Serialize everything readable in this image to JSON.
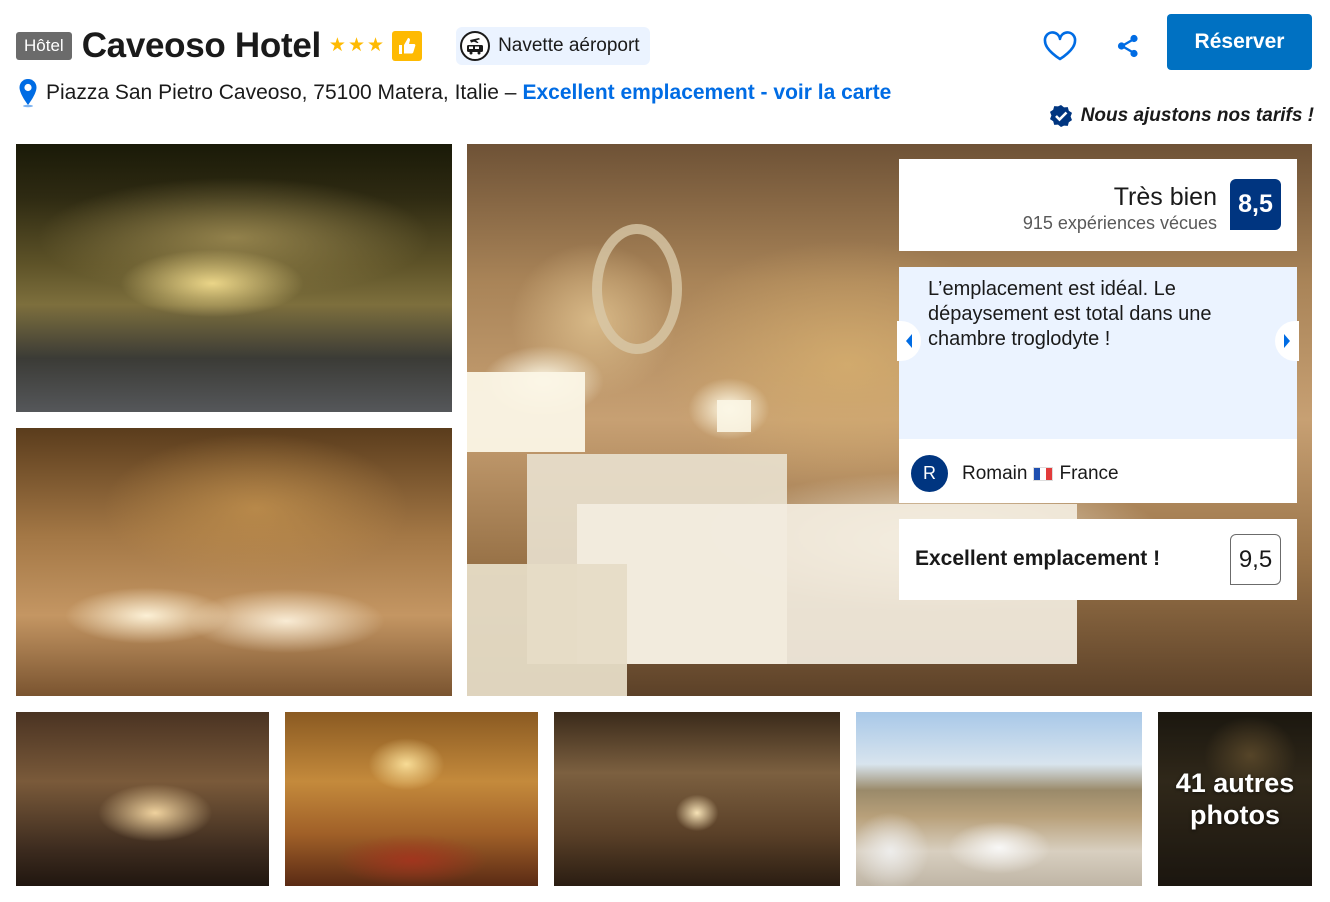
{
  "header": {
    "property_type": "Hôtel",
    "hotel_name": "Caveoso Hotel",
    "star_count": 3,
    "star_glyph": "★",
    "badge_icon": "thumbs-up-icon",
    "facility_label": "Navette aéroport",
    "facility_icon": "airport-shuttle-icon",
    "address": "Piazza San Pietro Caveoso, 75100 Matera, Italie –",
    "map_link": "Excellent emplacement - voir la carte",
    "reserve_label": "Réserver",
    "price_match": "Nous ajustons nos tarifs !",
    "colors": {
      "brand_blue": "#0071c2",
      "link_blue": "#006ce4",
      "score_navy": "#003580",
      "star_yellow": "#feba02",
      "quote_bg": "#ebf3ff"
    }
  },
  "review_summary": {
    "rating_word": "Très bien",
    "review_count": "915 expériences vécues",
    "score": "8,5"
  },
  "featured_review": {
    "quote": "L’emplacement est idéal. Le dépaysement est total dans une chambre troglodyte !",
    "avatar_initial": "R",
    "reviewer_name": "Romain",
    "reviewer_country": "France"
  },
  "location_rating": {
    "label": "Excellent emplacement !",
    "score": "9,5"
  },
  "gallery": {
    "more_photos_label": "41 autres photos"
  }
}
